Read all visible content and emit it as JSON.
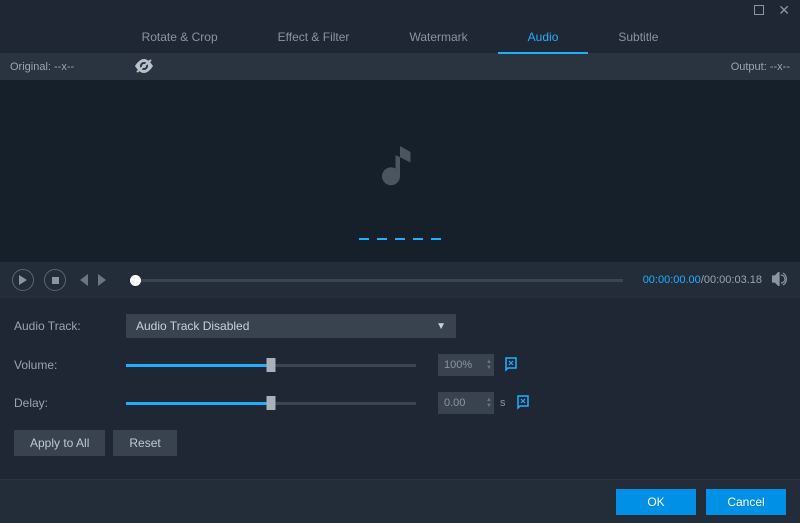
{
  "titlebar": {
    "maximize": "□",
    "close": "✕"
  },
  "tabs": {
    "items": [
      {
        "label": "Rotate & Crop"
      },
      {
        "label": "Effect & Filter"
      },
      {
        "label": "Watermark"
      },
      {
        "label": "Audio"
      },
      {
        "label": "Subtitle"
      }
    ],
    "active_index": 3
  },
  "subbar": {
    "original_label": "Original: --x--",
    "output_label": "Output: --x--"
  },
  "player": {
    "current_time": "00:00:00.00",
    "separator": "/",
    "total_time": "00:00:03.18"
  },
  "settings": {
    "audio_track_label": "Audio Track:",
    "audio_track_value": "Audio Track Disabled",
    "volume_label": "Volume:",
    "volume_value": "100%",
    "volume_percent": 50,
    "delay_label": "Delay:",
    "delay_value": "0.00",
    "delay_unit": "s",
    "delay_percent": 50,
    "apply_all_label": "Apply to All",
    "reset_label": "Reset"
  },
  "footer": {
    "ok_label": "OK",
    "cancel_label": "Cancel"
  }
}
